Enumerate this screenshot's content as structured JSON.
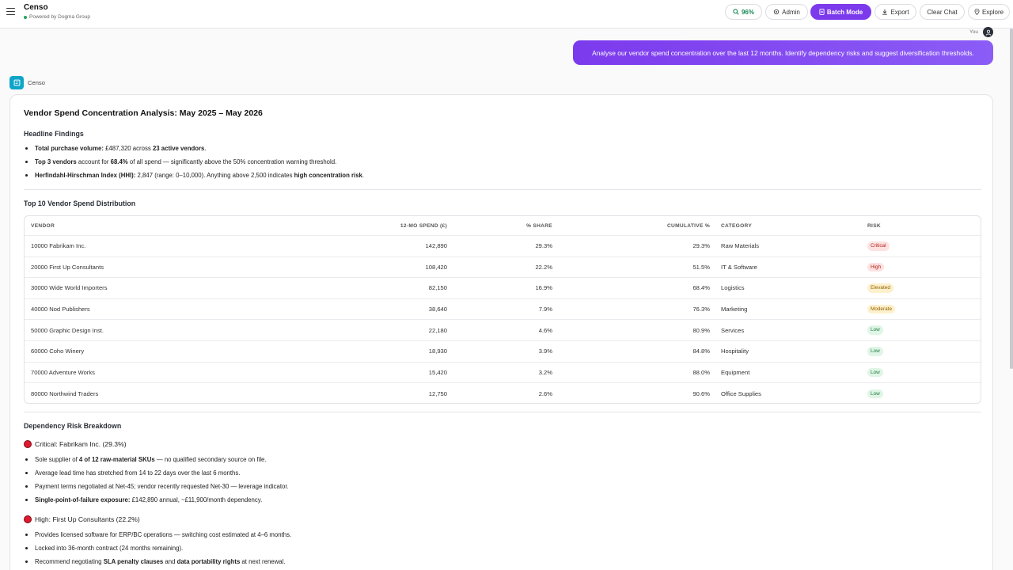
{
  "header": {
    "app_title": "Censo",
    "subtitle": "Powered by Dogma Group",
    "score_button": "96%",
    "admin_button": "Admin",
    "batch_button": "Batch Mode",
    "export_button": "Export",
    "clear_button": "Clear Chat",
    "explore_button": "Explore"
  },
  "conversation": {
    "user_label": "You",
    "user_message": "Analyse our vendor spend concentration over the last 12 months. Identify dependency risks and suggest diversification thresholds.",
    "assistant_name": "Censo"
  },
  "report": {
    "title": "Vendor Spend Concentration Analysis: May 2025 – May 2026",
    "headline_heading": "Headline Findings",
    "findings": [
      {
        "bold": "Total purchase volume:",
        "text1": " £487,320 across ",
        "bold2": "23 active vendors",
        "text2": "."
      },
      {
        "bold": "Top 3 vendors",
        "text1": " account for ",
        "bold2": "68.4%",
        "text2": " of all spend — significantly above the 50% concentration warning threshold."
      },
      {
        "bold": "Herfindahl-Hirschman Index (HHI):",
        "text1": " 2,847 (range: 0–10,000). Anything above 2,500 indicates ",
        "bold2": "high concentration risk",
        "text2": "."
      }
    ],
    "table_heading": "Top 10 Vendor Spend Distribution",
    "columns": [
      "Vendor",
      "12-Mo Spend (£)",
      "% Share",
      "Cumulative %",
      "Category",
      "Risk"
    ],
    "rows": [
      {
        "vendor": "10000 Fabrikam Inc.",
        "spend": "142,890",
        "share": "29.3%",
        "cum": "29.3%",
        "category": "Raw Materials",
        "risk": "Critical"
      },
      {
        "vendor": "20000 First Up Consultants",
        "spend": "108,420",
        "share": "22.2%",
        "cum": "51.5%",
        "category": "IT & Software",
        "risk": "High"
      },
      {
        "vendor": "30000 Wide World Importers",
        "spend": "82,150",
        "share": "16.9%",
        "cum": "68.4%",
        "category": "Logistics",
        "risk": "Elevated"
      },
      {
        "vendor": "40000 Nod Publishers",
        "spend": "38,640",
        "share": "7.9%",
        "cum": "76.3%",
        "category": "Marketing",
        "risk": "Moderate"
      },
      {
        "vendor": "50000 Graphic Design Inst.",
        "spend": "22,180",
        "share": "4.6%",
        "cum": "80.9%",
        "category": "Services",
        "risk": "Low"
      },
      {
        "vendor": "60000 Coho Winery",
        "spend": "18,930",
        "share": "3.9%",
        "cum": "84.8%",
        "category": "Hospitality",
        "risk": "Low"
      },
      {
        "vendor": "70000 Adventure Works",
        "spend": "15,420",
        "share": "3.2%",
        "cum": "88.0%",
        "category": "Equipment",
        "risk": "Low"
      },
      {
        "vendor": "80000 Northwind Traders",
        "spend": "12,750",
        "share": "2.6%",
        "cum": "90.6%",
        "category": "Office Supplies",
        "risk": "Low"
      }
    ],
    "risk_heading": "Dependency Risk Breakdown",
    "critical": {
      "title": "Critical: Fabrikam Inc. (29.3%)",
      "items": [
        {
          "text1": "Sole supplier of ",
          "bold": "4 of 12 raw-material SKUs",
          "text2": " — no qualified secondary source on file."
        },
        {
          "text1": "Average lead time has stretched from 14 to 22 days over the last 6 months.",
          "bold": "",
          "text2": ""
        },
        {
          "text1": "Payment terms negotiated at Net-45; vendor recently requested Net-30 — leverage indicator.",
          "bold": "",
          "text2": ""
        },
        {
          "text1": "",
          "bold": "Single-point-of-failure exposure:",
          "text2": " £142,890 annual, ~£11,900/month dependency."
        }
      ]
    },
    "high": {
      "title": "High: First Up Consultants (22.2%)",
      "items": [
        {
          "text1": "Provides licensed software for ERP/BC operations — switching cost estimated at 4–6 months.",
          "bold": "",
          "text2": "",
          "bold2": "",
          "text3": ""
        },
        {
          "text1": "Locked into 36-month contract (24 months remaining).",
          "bold": "",
          "text2": "",
          "bold2": "",
          "text3": ""
        },
        {
          "text1": "Recommend negotiating ",
          "bold": "SLA penalty clauses",
          "text2": " and ",
          "bold2": "data portability rights",
          "text3": " at next renewal."
        }
      ]
    }
  }
}
